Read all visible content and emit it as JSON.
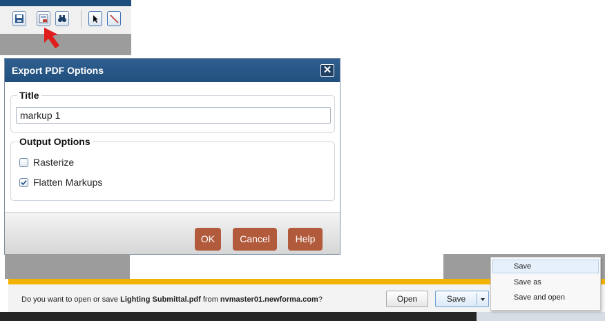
{
  "toolbar": {
    "icons": [
      "save-icon",
      "export-pdf-icon",
      "find-icon",
      "select-arrow-icon",
      "line-tool-icon"
    ]
  },
  "dialog": {
    "title": "Export PDF Options",
    "close_glyph": "✕",
    "title_section": {
      "legend": "Title",
      "value": "markup 1"
    },
    "output_section": {
      "legend": "Output Options",
      "options": [
        {
          "label": "Rasterize",
          "checked": false
        },
        {
          "label": "Flatten Markups",
          "checked": true
        }
      ]
    },
    "buttons": {
      "ok": "OK",
      "cancel": "Cancel",
      "help": "Help"
    },
    "button_color": "#b25a3c"
  },
  "download_bar": {
    "prompt_prefix": "Do you want to open or save ",
    "filename": "Lighting Submittal.pdf",
    "prompt_middle": " from ",
    "host": "nvmaster01.newforma.com",
    "prompt_suffix": "?",
    "open_label": "Open",
    "save_label": "Save",
    "accent_color": "#f2b200"
  },
  "save_menu": {
    "items": [
      "Save",
      "Save as",
      "Save and open"
    ],
    "highlighted": "Save"
  }
}
